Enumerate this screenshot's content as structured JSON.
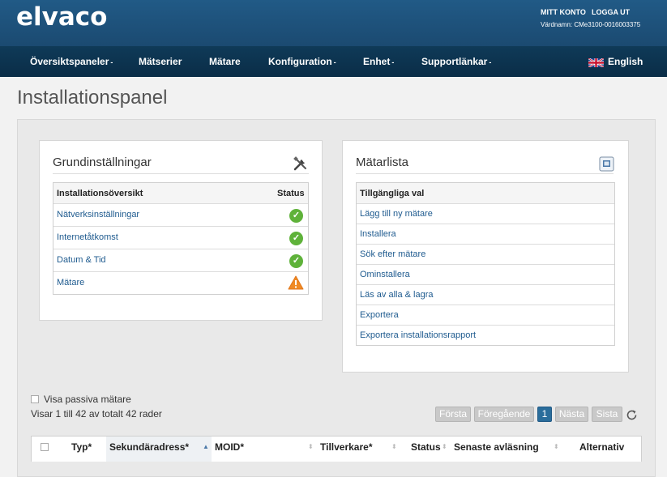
{
  "header": {
    "logo": "elvaco",
    "account_link": "MITT KONTO",
    "logout_link": "LOGGA UT",
    "hostname": "Värdnamn: CMe3100-0016003375"
  },
  "nav": {
    "items": [
      {
        "label": "Översiktspaneler",
        "caret": "-"
      },
      {
        "label": "Mätserier",
        "caret": ""
      },
      {
        "label": "Mätare",
        "caret": ""
      },
      {
        "label": "Konfiguration",
        "caret": "-"
      },
      {
        "label": "Enhet",
        "caret": "-"
      },
      {
        "label": "Supportlänkar",
        "caret": "-"
      }
    ],
    "language": "English"
  },
  "page": {
    "title": "Installationspanel"
  },
  "basic_settings": {
    "title": "Grundinställningar",
    "col_overview": "Installationsöversikt",
    "col_status": "Status",
    "rows": [
      {
        "label": "Nätverksinställningar",
        "status": "ok"
      },
      {
        "label": "Internetåtkomst",
        "status": "ok"
      },
      {
        "label": "Datum & Tid",
        "status": "ok"
      },
      {
        "label": "Mätare",
        "status": "warning"
      }
    ]
  },
  "meter_list": {
    "title": "Mätarlista",
    "col_options": "Tillgängliga val",
    "items": [
      "Lägg till ny mätare",
      "Installera",
      "Sök efter mätare",
      "Ominstallera",
      "Läs av alla & lagra",
      "Exportera",
      "Exportera installationsrapport"
    ]
  },
  "controls": {
    "show_passive_label": "Visa passiva mätare",
    "show_passive_checked": false,
    "rows_info": "Visar 1 till 42 av totalt 42 rader"
  },
  "pagination": {
    "first": "Första",
    "prev": "Föregående",
    "current": "1",
    "next": "Nästa",
    "last": "Sista"
  },
  "grid": {
    "columns": [
      "Typ*",
      "Sekundäradress*",
      "MOID*",
      "Tillverkare*",
      "Status",
      "Senaste avläsning",
      "Alternativ"
    ]
  },
  "colors": {
    "header_top": "#215a86",
    "nav_bg": "#0f3a58",
    "link": "#1f5b8f",
    "ok": "#5fb23a",
    "warning": "#f08a24",
    "page_active": "#2a6d9b"
  }
}
